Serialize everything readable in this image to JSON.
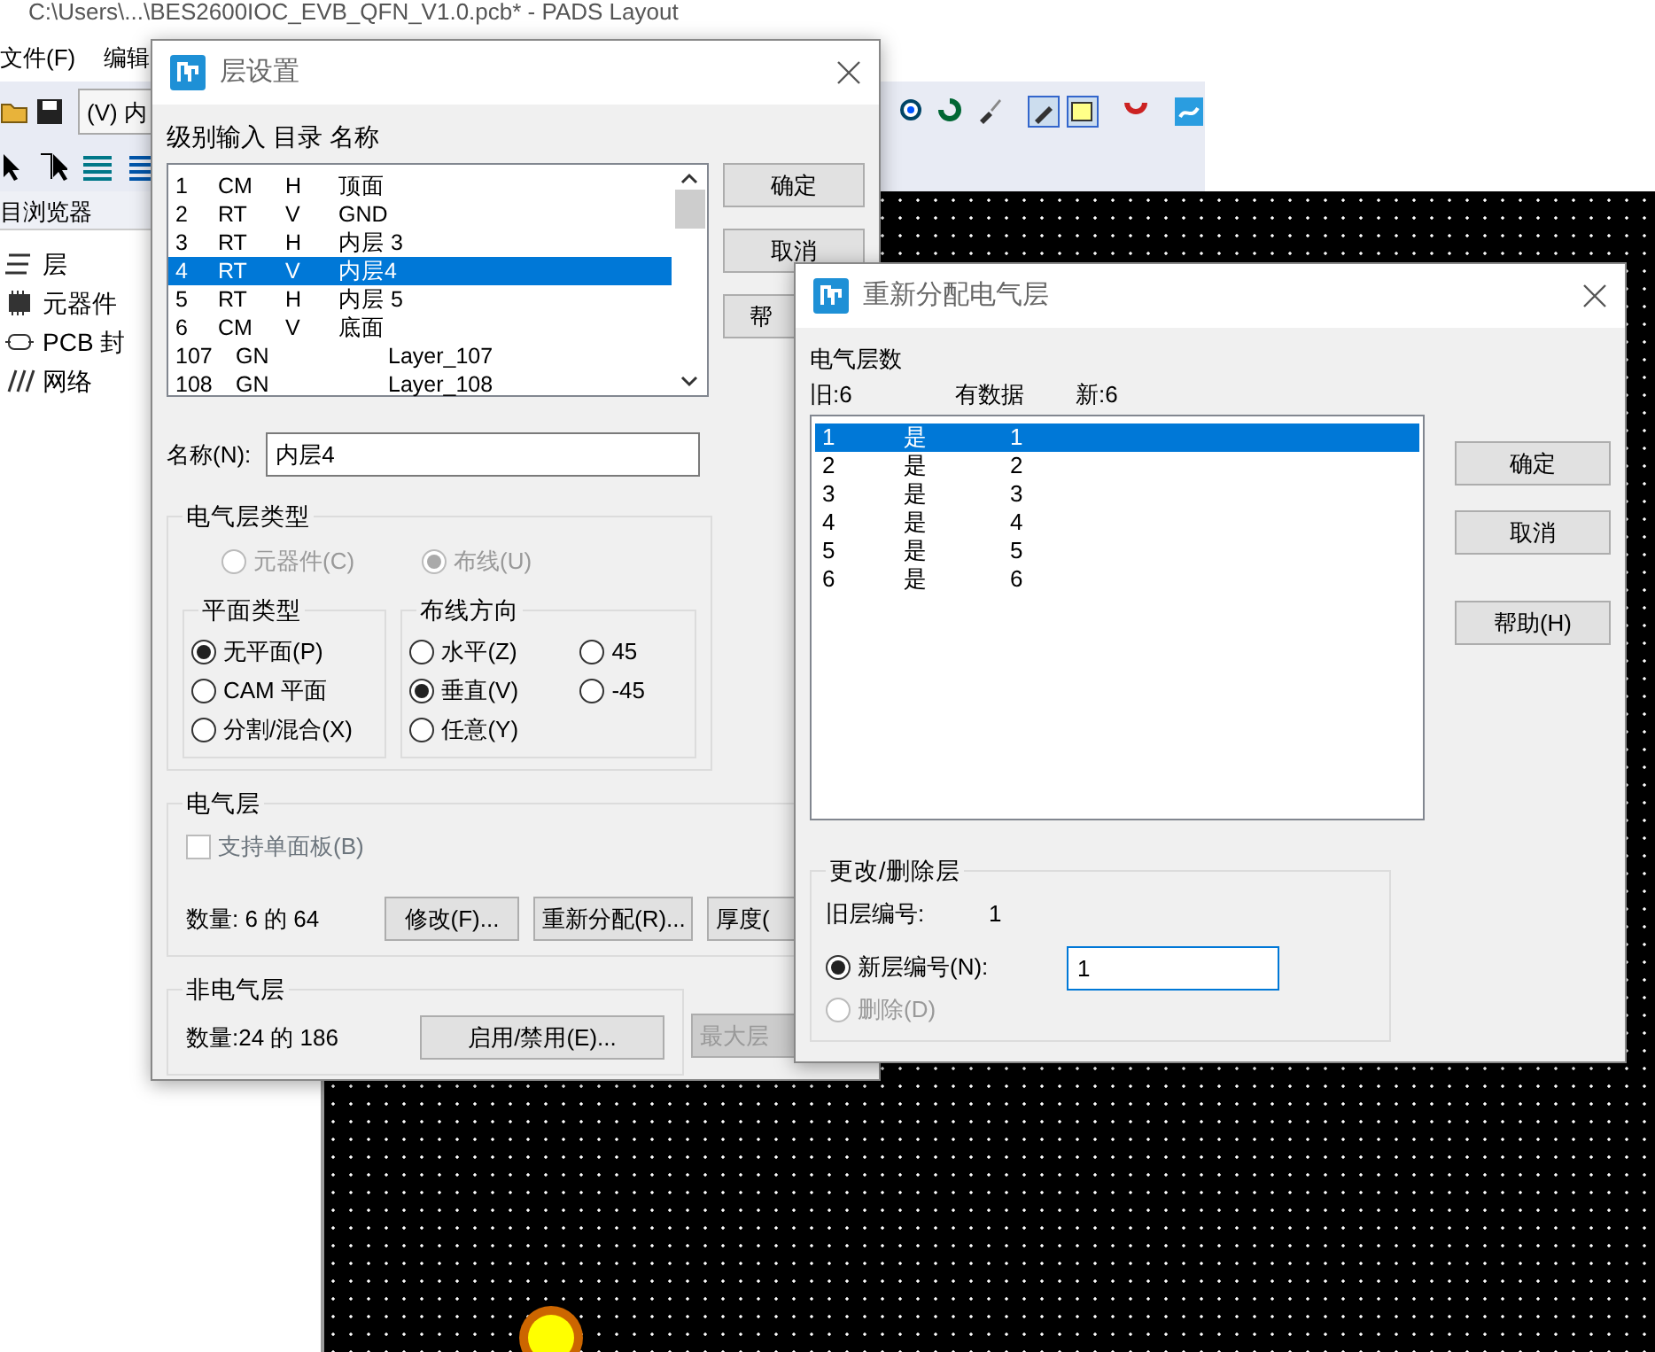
{
  "app": {
    "title": "C:\\Users\\...\\BES2600IOC_EVB_QFN_V1.0.pcb* - PADS Layout",
    "menu": [
      "文件(F)",
      "编辑"
    ],
    "layer_select": "(V) 内",
    "browser_title": "目浏览器",
    "tree": [
      {
        "label": "层"
      },
      {
        "label": "元器件"
      },
      {
        "label": "PCB 封"
      },
      {
        "label": "网络"
      }
    ]
  },
  "layer_dialog": {
    "title": "层设置",
    "list_header": "级别输入 目录 名称",
    "layers": [
      {
        "level": "1",
        "type": "CM",
        "dir": "H",
        "name": "顶面",
        "selected": false
      },
      {
        "level": "2",
        "type": "RT",
        "dir": "V",
        "name": "GND",
        "selected": false
      },
      {
        "level": "3",
        "type": "RT",
        "dir": "H",
        "name": "内层 3",
        "selected": false
      },
      {
        "level": "4",
        "type": "RT",
        "dir": "V",
        "name": "内层4",
        "selected": true
      },
      {
        "level": "5",
        "type": "RT",
        "dir": "H",
        "name": "内层 5",
        "selected": false
      },
      {
        "level": "6",
        "type": "CM",
        "dir": "V",
        "name": "底面",
        "selected": false
      },
      {
        "level": "107",
        "type": "GN",
        "name": "Layer_107",
        "selected": false
      },
      {
        "level": "108",
        "type": "GN",
        "name": "Layer_108",
        "selected": false
      }
    ],
    "buttons": [
      "确定",
      "取消",
      "帮"
    ],
    "name_label": "名称(N):",
    "name_value": "内层4",
    "electrical_type": {
      "label": "电气层类型",
      "options": [
        {
          "label": "元器件(C)",
          "checked": false,
          "disabled": true
        },
        {
          "label": "布线(U)",
          "checked": true,
          "disabled": true
        }
      ]
    },
    "plane_type": {
      "label": "平面类型",
      "options": [
        {
          "label": "无平面(P)",
          "checked": true,
          "disabled": false
        },
        {
          "label": "CAM 平面",
          "checked": false,
          "disabled": false
        },
        {
          "label": "分割/混合(X)",
          "checked": false,
          "disabled": false
        }
      ]
    },
    "routing_direction": {
      "label": "布线方向",
      "options": [
        {
          "label": "水平(Z)",
          "checked": false,
          "disabled": false
        },
        {
          "label": "45",
          "checked": false,
          "disabled": false
        },
        {
          "label": "垂直(V)",
          "checked": true,
          "disabled": false
        },
        {
          "label": "-45",
          "checked": false,
          "disabled": false
        },
        {
          "label": "任意(Y)",
          "checked": false,
          "disabled": false
        }
      ]
    },
    "electrical": {
      "label": "电气层",
      "single_sided": {
        "label": "支持单面板(B)",
        "checked": false,
        "disabled": true
      },
      "count": "数量: 6 的 64",
      "buttons": [
        "修改(F)...",
        "重新分配(R)...",
        "厚度("
      ]
    },
    "non_electrical": {
      "label": "非电气层",
      "count": "数量:24 的 186",
      "button": "启用/禁用(E)..."
    },
    "max_layer_button": {
      "label": "最大层",
      "disabled": true
    }
  },
  "reassign_dialog": {
    "title": "重新分配电气层",
    "count_label": "电气层数",
    "old": "旧:6",
    "has_data": "有数据",
    "new": "新:6",
    "rows": [
      {
        "old": "1",
        "data": "是",
        "new": "1",
        "selected": true
      },
      {
        "old": "2",
        "data": "是",
        "new": "2",
        "selected": false
      },
      {
        "old": "3",
        "data": "是",
        "new": "3",
        "selected": false
      },
      {
        "old": "4",
        "data": "是",
        "new": "4",
        "selected": false
      },
      {
        "old": "5",
        "data": "是",
        "new": "5",
        "selected": false
      },
      {
        "old": "6",
        "data": "是",
        "new": "6",
        "selected": false
      }
    ],
    "buttons": [
      "确定",
      "取消",
      "帮助(H)"
    ],
    "change_group": {
      "label": "更改/删除层",
      "old_label": "旧层编号:",
      "old_value": "1",
      "options": [
        {
          "label": "新层编号(N):",
          "checked": true,
          "disabled": false
        },
        {
          "label": "删除(D)",
          "checked": false,
          "disabled": true
        }
      ],
      "new_value": "1"
    }
  }
}
